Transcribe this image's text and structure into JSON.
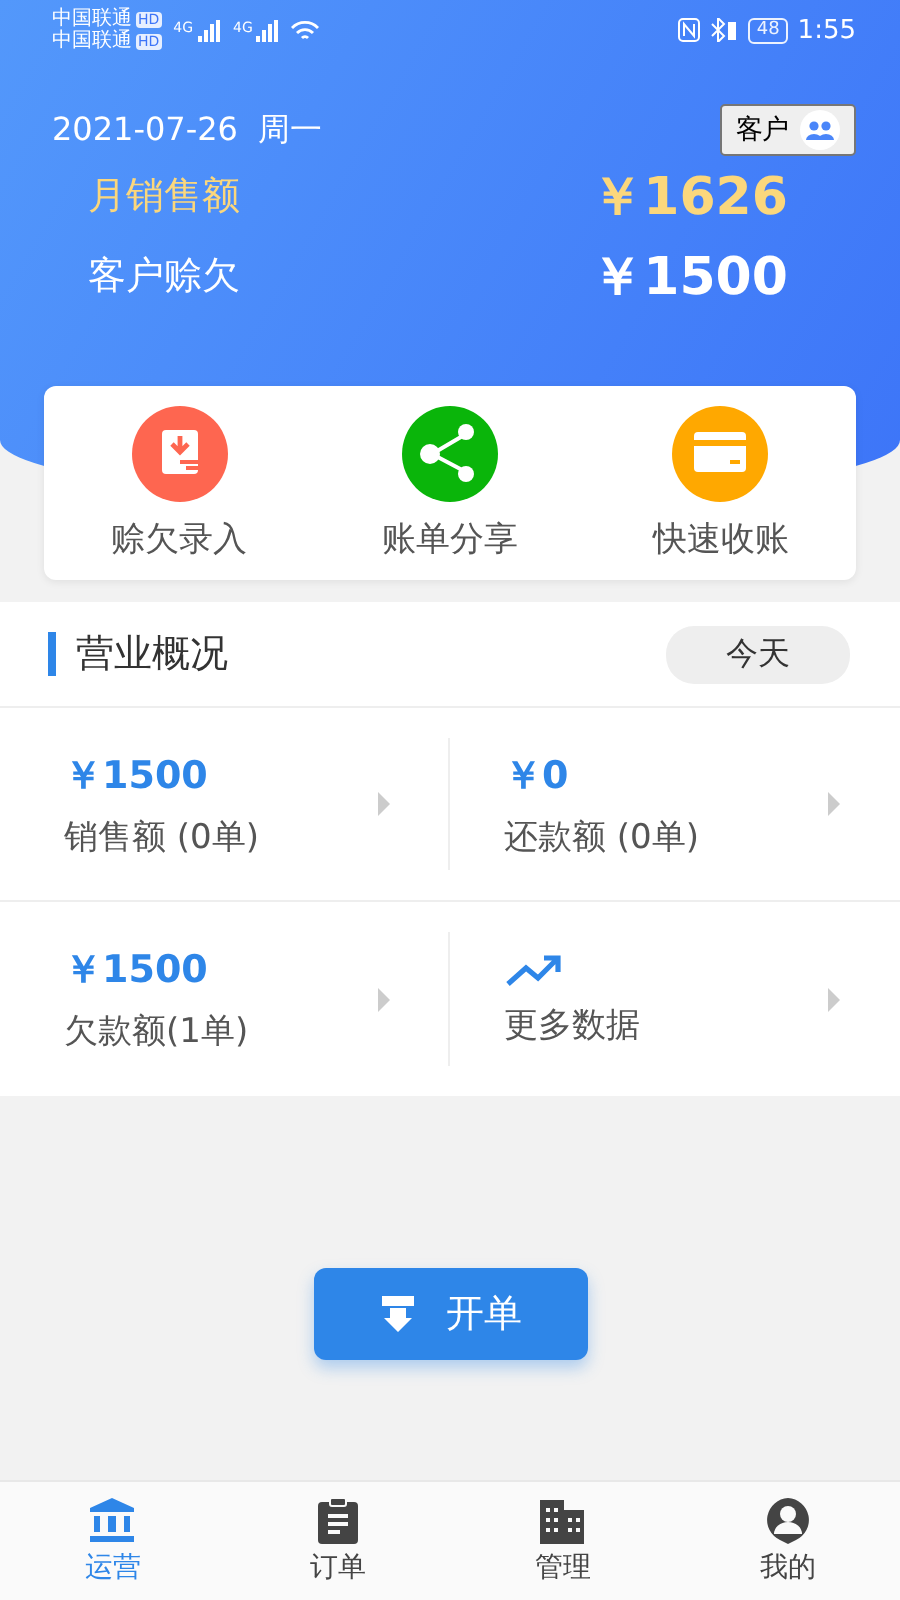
{
  "status_bar": {
    "carriers": [
      {
        "name": "中国联通",
        "badge": "HD"
      },
      {
        "name": "中国联通",
        "badge": "HD"
      }
    ],
    "network": [
      "4G",
      "4G"
    ],
    "battery": "48",
    "time": "1:55"
  },
  "header": {
    "date": "2021-07-26",
    "weekday": "周一",
    "customer_link": "客户",
    "stats": [
      {
        "kind": "highlight",
        "label": "月销售额",
        "value": "￥1626"
      },
      {
        "kind": "plain",
        "label": "客户赊欠",
        "value": "￥1500"
      }
    ]
  },
  "actions": [
    {
      "kind": "debt",
      "label": "赊欠录入",
      "color": "#fe6650"
    },
    {
      "kind": "share",
      "label": "账单分享",
      "color": "#0ab50a"
    },
    {
      "kind": "card",
      "label": "快速收账",
      "color": "#ffa800"
    }
  ],
  "overview": {
    "title": "营业概况",
    "period": "今天",
    "cells": [
      {
        "kind": "amount",
        "value": "￥1500",
        "label": "销售额 (0单)"
      },
      {
        "kind": "amount",
        "value": "￥0",
        "label": "还款额 (0单)"
      },
      {
        "kind": "amount",
        "value": "￥1500",
        "label": "欠款额(1单)"
      },
      {
        "kind": "trend",
        "label": "更多数据"
      }
    ]
  },
  "new_order_button": "开单",
  "tabs": [
    {
      "kind": "bank",
      "label": "运营",
      "selected": true
    },
    {
      "kind": "clipboard",
      "label": "订单",
      "selected": false
    },
    {
      "kind": "building",
      "label": "管理",
      "selected": false
    },
    {
      "kind": "person",
      "label": "我的",
      "selected": false
    }
  ]
}
